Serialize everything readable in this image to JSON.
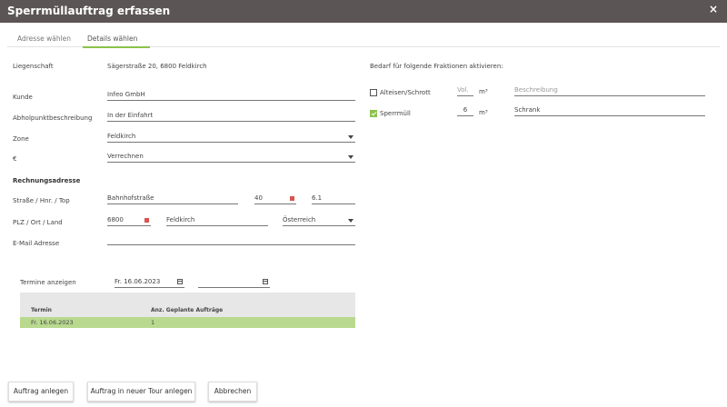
{
  "window": {
    "title": "Sperrmüllauftrag erfassen",
    "close_label": "×"
  },
  "tabs": [
    {
      "label": "Adresse wählen",
      "active": false
    },
    {
      "label": "Details wählen",
      "active": true
    }
  ],
  "form": {
    "liegenschaft_label": "Liegenschaft",
    "liegenschaft_value": "Sägerstraße 20, 6800 Feldkirch",
    "kunde_label": "Kunde",
    "kunde_value": "Infeo GmbH",
    "abholpunkt_label": "Abholpunktbeschreibung",
    "abholpunkt_value": "In der Einfahrt",
    "zone_label": "Zone",
    "zone_value": "Feldkirch",
    "euro_label": "€",
    "euro_value": "Verrechnen",
    "rechnungsadresse_heading": "Rechnungsadresse",
    "strasse_label": "Straße / Hnr. / Top",
    "strasse_value": "Bahnhofstraße",
    "hnr_value": "40",
    "top_value": "6.1",
    "plz_label": "PLZ / Ort / Land",
    "plz_value": "6800",
    "ort_value": "Feldkirch",
    "land_value": "Österreich",
    "email_label": "E-Mail Adresse",
    "email_value": ""
  },
  "fraktionen": {
    "heading": "Bedarf für folgende Fraktionen aktivieren:",
    "items": [
      {
        "label": "Alteisen/Schrott",
        "checked": false,
        "vol": "Vol.",
        "unit": "m³",
        "desc": "Beschreibung"
      },
      {
        "label": "Sperrmüll",
        "checked": true,
        "vol": "6",
        "unit": "m³",
        "desc": "Schrank"
      }
    ]
  },
  "termine": {
    "label": "Termine anzeigen",
    "from": "Fr. 16.06.2023",
    "to": "",
    "table": {
      "headers": [
        "Termin",
        "Anz. Geplante Aufträge"
      ],
      "rows": [
        {
          "termin": "Fr. 16.06.2023",
          "anzahl": "1"
        }
      ]
    }
  },
  "buttons": {
    "auftrag_anlegen": "Auftrag anlegen",
    "neue_tour": "Auftrag in neuer Tour anlegen",
    "abbrechen": "Abbrechen"
  },
  "colors": {
    "titlebar": "#5c5555",
    "accent": "#8bc34a",
    "selected_row": "#b9d98f",
    "required": "#d9534f"
  }
}
